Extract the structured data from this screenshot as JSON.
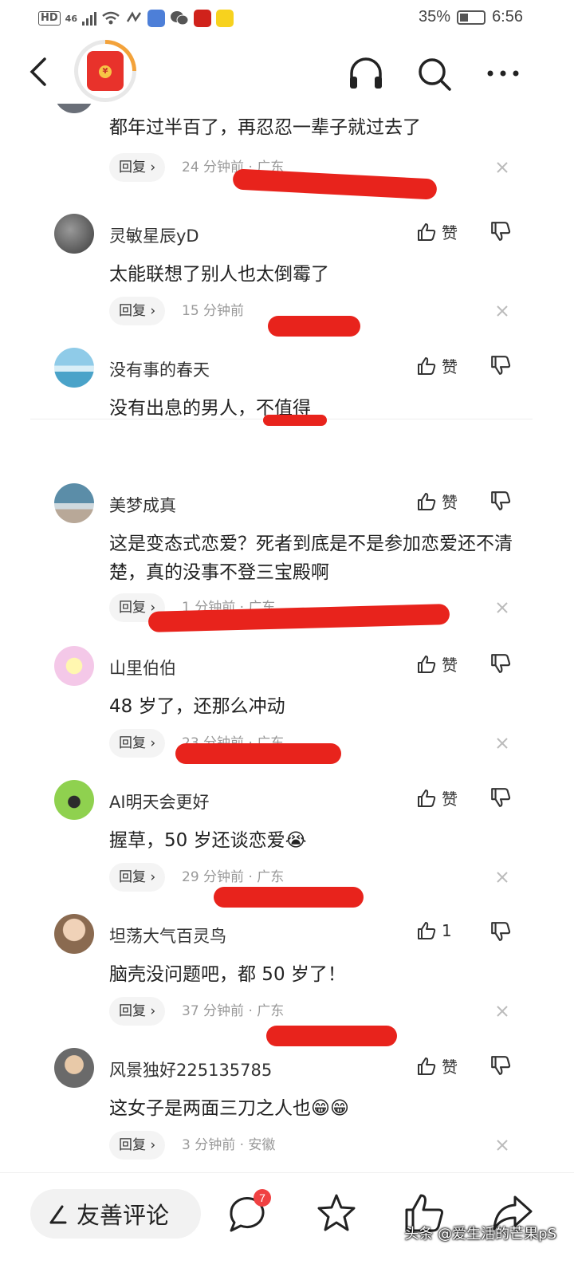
{
  "status_bar": {
    "hd": "HD",
    "network": "46",
    "battery": "35%",
    "time": "6:56"
  },
  "comments": [
    {
      "name": "",
      "text": "都年过半百了，再忍忍一辈子就过去了",
      "reply": "回复 ›",
      "meta": "24 分钟前 · 广东",
      "likes": "",
      "avatar_color": "#6a6f78"
    },
    {
      "name": "灵敏星辰yD",
      "text": "太能联想了别人也太倒霉了",
      "reply": "回复 ›",
      "meta": "15 分钟前",
      "likes": "赞",
      "avatar_color": "#4a4a4a"
    },
    {
      "name": "没有事的春天",
      "text": "没有出息的男人，不值得",
      "reply": "",
      "meta": "",
      "likes": "赞",
      "avatar_color": "#6cb4d8"
    },
    {
      "name": "美梦成真",
      "text": "这是变态式恋爱？死者到底是不是参加恋爱还不清楚，真的没事不登三宝殿啊",
      "reply": "回复 ›",
      "meta": "1 分钟前 · 广东",
      "likes": "赞",
      "avatar_color": "#7d98a8"
    },
    {
      "name": "山里伯伯",
      "text": "48 岁了，还那么冲动",
      "reply": "回复 ›",
      "meta": "23 分钟前 · 广东",
      "likes": "赞",
      "avatar_color": "#f4c8e8"
    },
    {
      "name": "AI明天会更好",
      "text": "握草，50 岁还谈恋爱😭",
      "reply": "回复 ›",
      "meta": "29 分钟前 · 广东",
      "likes": "赞",
      "avatar_color": "#8fd14f"
    },
    {
      "name": "坦荡大气百灵鸟",
      "text": "脑壳没问题吧，都 50 岁了！",
      "reply": "回复 ›",
      "meta": "37 分钟前 · 广东",
      "likes": "1",
      "avatar_color": "#c9a27a"
    },
    {
      "name": "风景独好225135785",
      "text": "这女子是两面三刀之人也😁😁",
      "reply": "回复 ›",
      "meta": "3 分钟前 · 安徽",
      "likes": "赞",
      "avatar_color": "#9a8f86"
    }
  ],
  "bottom_bar": {
    "comment_placeholder": "友善评论",
    "comment_count_badge": "7",
    "watermark": "头条 @爱生活的芒果pS"
  },
  "colors": {
    "accent_red": "#e8231c",
    "badge_red": "#f04142",
    "progress_orange": "#f3a23a"
  }
}
